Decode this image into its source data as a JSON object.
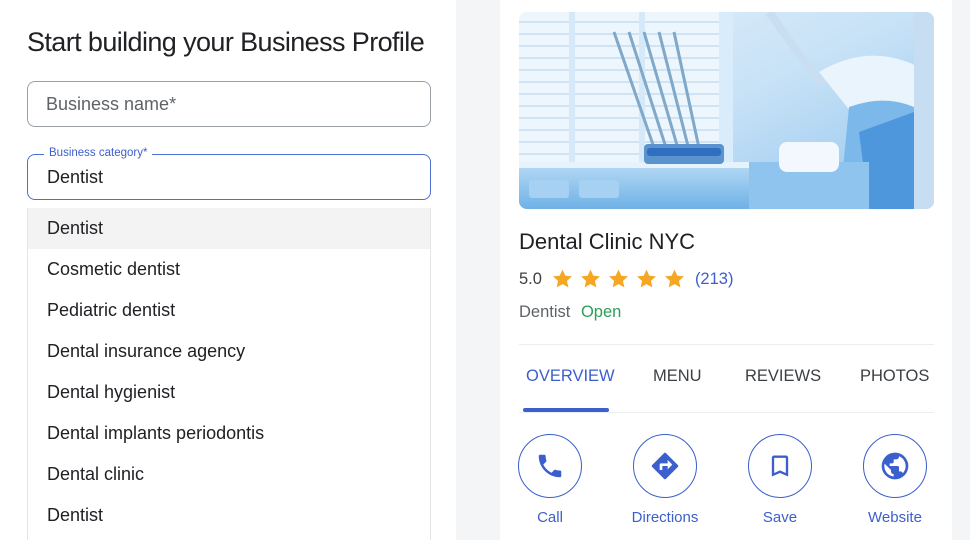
{
  "form": {
    "title": "Start building your Business Profile",
    "business_name_placeholder": "Business name*",
    "category_label": "Business category*",
    "category_value": "Dentist",
    "suggestions": [
      "Dentist",
      "Cosmetic dentist",
      "Pediatric dentist",
      "Dental insurance agency",
      "Dental hygienist",
      "Dental implants periodontis",
      "Dental clinic",
      "Dentist"
    ]
  },
  "profile": {
    "name": "Dental Clinic NYC",
    "rating": "5.0",
    "star_count": 5,
    "reviews": "(213)",
    "category": "Dentist",
    "status": "Open",
    "tabs": [
      "OVERVIEW",
      "MENU",
      "REVIEWS",
      "PHOTOS"
    ],
    "actions": [
      {
        "label": "Call",
        "icon": "phone-icon"
      },
      {
        "label": "Directions",
        "icon": "directions-icon"
      },
      {
        "label": "Save",
        "icon": "bookmark-icon"
      },
      {
        "label": "Website",
        "icon": "globe-icon"
      }
    ]
  },
  "colors": {
    "accent": "#3b5fcc",
    "star": "#f5a623",
    "open": "#2e9e58",
    "field_focus_border": "#4c6fd1"
  }
}
